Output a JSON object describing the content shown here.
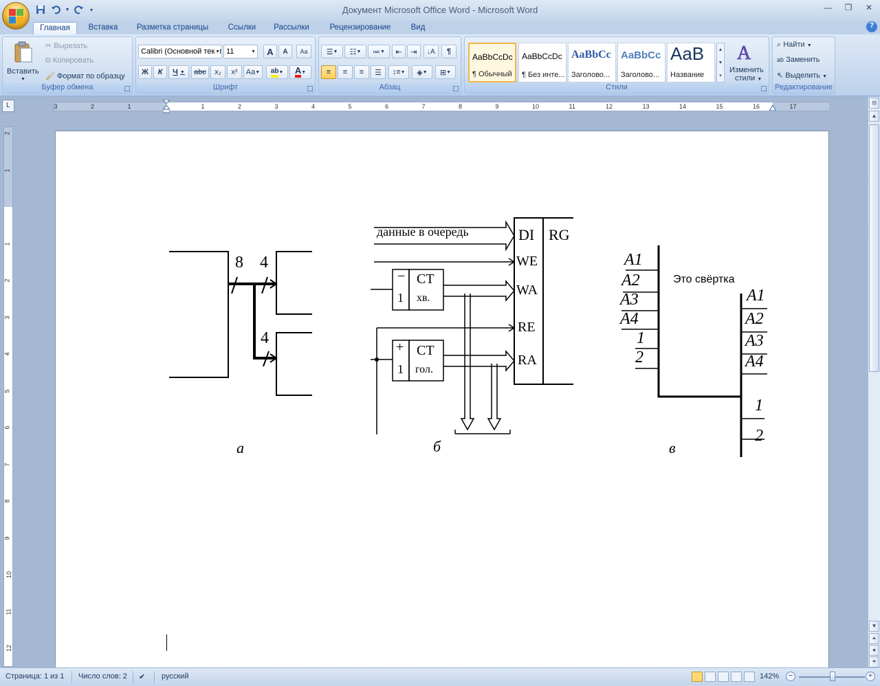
{
  "window": {
    "title": "Документ Microsoft Office Word - Microsoft Word"
  },
  "qat": {
    "save_icon": "save-icon",
    "undo_icon": "undo-icon",
    "redo_icon": "redo-icon"
  },
  "tabs": [
    {
      "label": "Главная",
      "active": true
    },
    {
      "label": "Вставка"
    },
    {
      "label": "Разметка страницы"
    },
    {
      "label": "Ссылки"
    },
    {
      "label": "Рассылки"
    },
    {
      "label": "Рецензирование"
    },
    {
      "label": "Вид"
    }
  ],
  "clipboard": {
    "paste_label": "Вставить",
    "cut_label": "Вырезать",
    "copy_label": "Копировать",
    "format_painter_label": "Формат по образцу",
    "group_label": "Буфер обмена"
  },
  "font": {
    "name": "Calibri (Основной текст)",
    "size": "11",
    "bold": "Ж",
    "italic": "К",
    "underline": "Ч",
    "strike": "abc",
    "subscript": "x₂",
    "superscript": "x²",
    "case": "Aa",
    "grow": "A",
    "shrink": "A",
    "group_label": "Шрифт"
  },
  "paragraph": {
    "group_label": "Абзац",
    "pilcrow": "¶"
  },
  "styles": {
    "group_label": "Стили",
    "tiles": [
      {
        "sample": "AaBbCcDc",
        "name": "¶ Обычный"
      },
      {
        "sample": "AaBbCcDc",
        "name": "¶ Без инте..."
      },
      {
        "sample": "AaBbCc",
        "name": "Заголово..."
      },
      {
        "sample": "AaBbCc",
        "name": "Заголово..."
      },
      {
        "sample": "AaB",
        "name": "Название"
      }
    ],
    "change_styles_label_1": "Изменить",
    "change_styles_label_2": "стили"
  },
  "editing": {
    "group_label": "Редактирование",
    "find_label": "Найти",
    "replace_label": "Заменить",
    "select_label": "Выделить"
  },
  "ruler": {
    "h_ticks": [
      "3",
      "2",
      "1",
      "1",
      "2",
      "3",
      "4",
      "5",
      "6",
      "7",
      "8",
      "9",
      "10",
      "11",
      "12",
      "13",
      "14",
      "15",
      "16",
      "17"
    ],
    "v_ticks": [
      "2",
      "1",
      "1",
      "2",
      "3",
      "4",
      "5",
      "6",
      "7",
      "8",
      "9",
      "10",
      "11",
      "12"
    ]
  },
  "document": {
    "diagram": {
      "a_label_8": "8",
      "a_label_4top": "4",
      "a_label_4bot": "4",
      "b_data_in": "данные в очередь",
      "b_DI": "DI",
      "b_RG": "RG",
      "b_WE": "WE",
      "b_WA": "WA",
      "b_RE": "RE",
      "b_RA": "RA",
      "b_ct1_sign": "−",
      "b_ct1_one": "1",
      "b_ct1_ct": "CT",
      "b_ct1_name": "хв.",
      "b_ct2_sign": "+",
      "b_ct2_one": "1",
      "b_ct2_ct": "CT",
      "b_ct2_name": "гол.",
      "v_left": [
        "A1",
        "A2",
        "A3",
        "A4",
        "1",
        "2"
      ],
      "v_right": [
        "A1",
        "A2",
        "A3",
        "A4",
        "1",
        "2"
      ]
    },
    "annotation": "Это свёртка",
    "captions": {
      "a": "а",
      "b": "б",
      "v": "в"
    }
  },
  "status": {
    "page": "Страница: 1 из 1",
    "words": "Число слов: 2",
    "language": "русский",
    "zoom": "142%"
  }
}
